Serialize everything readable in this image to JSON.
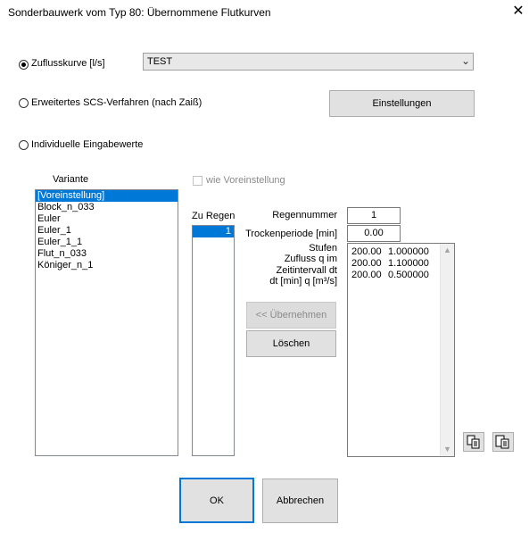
{
  "window": {
    "title": "Sonderbauwerk vom Typ 80: Übernommene Flutkurven",
    "close_glyph": "✕"
  },
  "options": {
    "zufluss_label": "Zuflusskurve [l/s]",
    "zufluss_selected": true,
    "zufluss_combo_value": "TEST",
    "scs_label": "Erweitertes SCS-Verfahren (nach Zaiß)",
    "scs_selected": false,
    "individuell_label": "Individuelle Eingabewerte",
    "individuell_selected": false
  },
  "buttons": {
    "einstellungen": "Einstellungen",
    "uebernehmen": "<< Übernehmen",
    "loeschen": "Löschen",
    "ok": "OK",
    "abbrechen": "Abbrechen"
  },
  "variante": {
    "header": "Variante",
    "items": [
      "[Voreinstellung]",
      "Block_n_033",
      "Euler",
      "Euler_1",
      "Euler_1_1",
      "Flut_n_033",
      "Königer_n_1"
    ],
    "selected_index": 0
  },
  "wie_voreinstellung_label": "wie Voreinstellung",
  "zu_regen": {
    "header": "Zu Regen",
    "items": [
      "1"
    ]
  },
  "fields": {
    "regennummer_label": "Regennummer",
    "regennummer_value": "1",
    "trockenperiode_label": "Trockenperiode [min]",
    "trockenperiode_value": "0.00",
    "stufen_lines": [
      "Stufen",
      "Zufluss q im",
      "Zeitintervall dt",
      "dt [min]    q [m³/s]"
    ]
  },
  "stufen_rows": [
    {
      "dt": "200.00",
      "q": "1.000000"
    },
    {
      "dt": "200.00",
      "q": "1.100000"
    },
    {
      "dt": "200.00",
      "q": "0.500000"
    }
  ]
}
